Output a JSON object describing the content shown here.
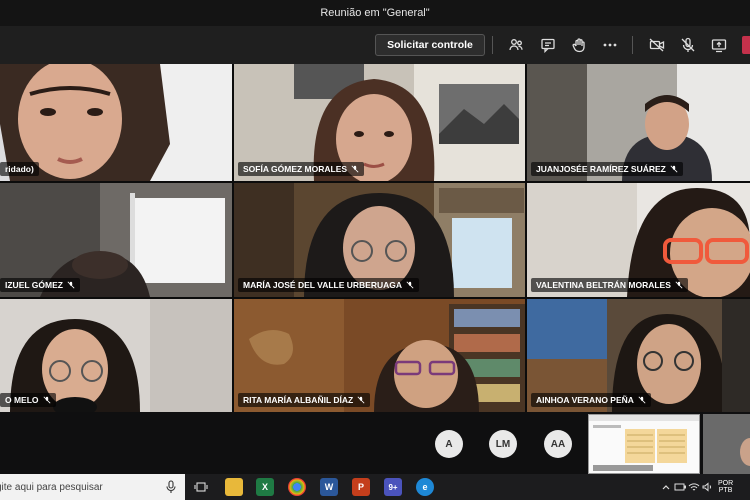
{
  "window": {
    "title": "Reunião em \"General\""
  },
  "toolbar": {
    "request_control_label": "Solicitar controle",
    "icons": [
      "participants-icon",
      "chat-icon",
      "raise-hand-icon",
      "more-options-icon",
      "camera-off-icon",
      "mic-off-icon",
      "share-screen-icon",
      "leave-icon"
    ]
  },
  "participants": [
    {
      "id": "p1",
      "label": "ridado)",
      "muted": false
    },
    {
      "id": "p2",
      "label": "SOFÍA GÓMEZ MORALES",
      "muted": true
    },
    {
      "id": "p3",
      "label": "JUANJOSÉE RAMÍREZ SUÁREZ",
      "muted": true
    },
    {
      "id": "p4",
      "label": "IZUEL GÓMEZ",
      "muted": true
    },
    {
      "id": "p5",
      "label": "MARÍA JOSÉ DEL VALLE URBERUAGA",
      "muted": true
    },
    {
      "id": "p6",
      "label": "VALENTINA BELTRÁN MORALES",
      "muted": true
    },
    {
      "id": "p7",
      "label": "O MELO",
      "muted": true
    },
    {
      "id": "p8",
      "label": "RITA MARÍA ALBAÑIL DÍAZ",
      "muted": true
    },
    {
      "id": "p9",
      "label": "AINHOA VERANO PEÑA",
      "muted": true
    }
  ],
  "overflow_avatars": [
    "A",
    "LM",
    "AA"
  ],
  "taskbar": {
    "search_placeholder": "gite aqui para pesquisar",
    "teams_badge": "9+",
    "lang_top": "POR",
    "lang_bottom": "PTB"
  },
  "colors": {
    "accent_leave": "#c4314b",
    "toolbar_bg": "#1f1f1f",
    "taskbar_bg": "#1c1c1e"
  }
}
